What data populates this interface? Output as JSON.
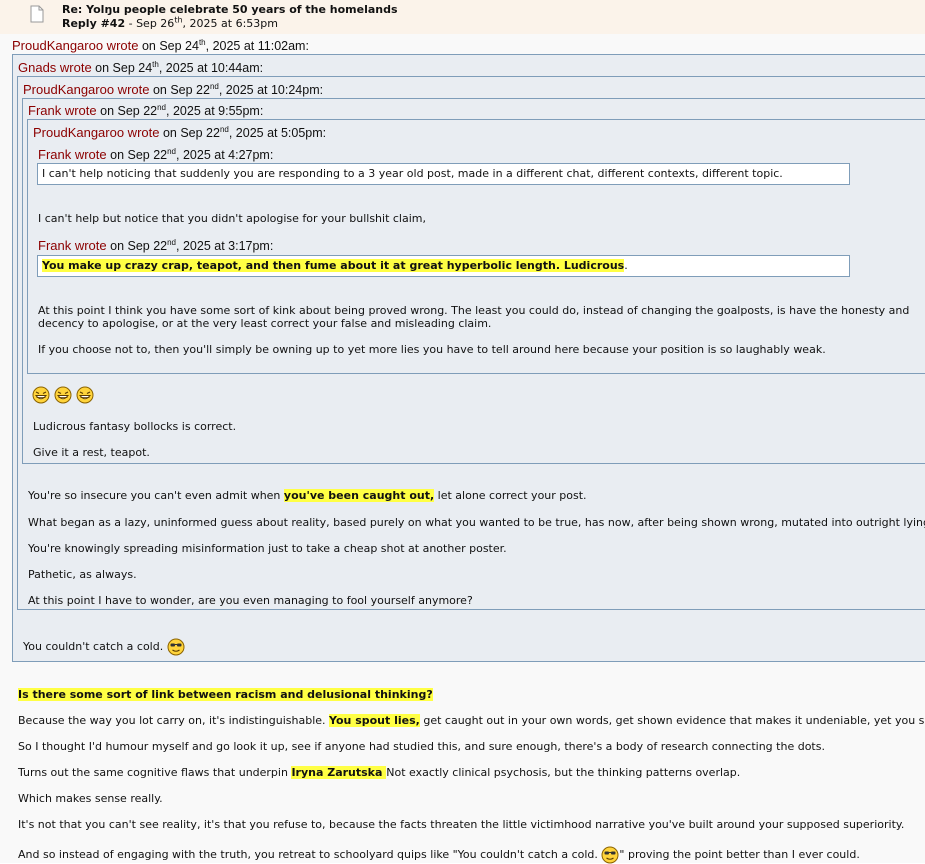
{
  "header": {
    "title": "Re: Yolŋu people celebrate 50 years of the homelands",
    "reply_label": "Reply #42",
    "date_pre": " - Sep 26",
    "date_sup": "th",
    "date_post": ", 2025 at 6:53pm"
  },
  "q0": {
    "author": "ProudKangaroo wrote",
    "pre": " on Sep 24",
    "sup": "th",
    "post": ", 2025 at 11:02am:"
  },
  "q1": {
    "author": "Gnads wrote",
    "pre": " on Sep 24",
    "sup": "th",
    "post": ", 2025 at 10:44am:"
  },
  "q2": {
    "author": "ProudKangaroo wrote",
    "pre": " on Sep 22",
    "sup": "nd",
    "post": ", 2025 at 10:24pm:"
  },
  "q3": {
    "author": "Frank wrote",
    "pre": " on Sep 22",
    "sup": "nd",
    "post": ", 2025 at 9:55pm:"
  },
  "q4": {
    "author": "ProudKangaroo wrote",
    "pre": " on Sep 22",
    "sup": "nd",
    "post": ", 2025 at 5:05pm:"
  },
  "q5": {
    "author": "Frank wrote",
    "pre": " on Sep 22",
    "sup": "nd",
    "post": ", 2025 at 4:27pm:",
    "quote_text": "I can't help noticing that suddenly you are responding to a 3 year old post, made in a different chat, different contexts, different topic."
  },
  "q4_body": {
    "notice": "I can't help but notice that you didn't apologise for your bullshit claim,"
  },
  "q6": {
    "author": "Frank wrote",
    "pre": " on Sep 22",
    "sup": "nd",
    "post": ", 2025 at 3:17pm:",
    "quote_text": "You make up crazy crap, teapot, and then fume about it at great hyperbolic length. Ludicrous",
    "quote_tail": "."
  },
  "q4_tail": {
    "p1a": "At this point I think you have some sort of kink about being proved wrong.  The least you could do, instead of changing the goalposts, is have the honesty and",
    "p1b": "decency to apologise, or at the very least correct your false and misleading claim.",
    "p2": "If you choose not to, then you'll simply be owning up to yet more lies you have to tell around here because your position is so laughably weak."
  },
  "q3_body": {
    "smileys": "laughing-icons",
    "p1": "Ludicrous fantasy bollocks is correct.",
    "p2": "Give it a rest, teapot."
  },
  "q2_body": {
    "p1_pre": "You're so insecure you can't even admit when ",
    "p1_hl": "you've been caught out,",
    "p1_post": " let alone correct your post.",
    "p2": "What began as a lazy, uninformed guess about reality, based purely on what you wanted to be true, has now, after being shown wrong, mutated into outright lying",
    "p3": "You're knowingly spreading misinformation just to take a cheap shot at another poster.",
    "p4": "Pathetic, as always.",
    "p5": "At this point I have to wonder, are you even managing to fool yourself anymore?"
  },
  "q1_body": {
    "p1": "You couldn't catch a cold. "
  },
  "post": {
    "heading": "Is there some sort of link between racism and delusional thinking?",
    "p1_pre": "Because the way you lot carry on, it's indistinguishable. ",
    "p1_hl": "You spout lies,",
    "p1_post": " get caught out in your own words, get shown evidence that makes it undeniable, yet you s",
    "p2": "So I thought I'd humour myself and go look it up, see if anyone had studied this, and sure enough, there's a body of research connecting the dots.",
    "p3_pre": "Turns out the same cognitive flaws that underpin ",
    "p3_hl": "Iryna Zarutska ",
    "p3_post": " Not exactly clinical psychosis, but the thinking patterns overlap.",
    "p4": "Which makes sense really.",
    "p5": "It's not that you can't see reality, it's that you refuse to, because the facts threaten the little victimhood narrative you've built around your supposed superiority.",
    "p6_pre": "And so instead of engaging with the truth, you retreat to schoolyard quips like \"You couldn't catch a cold. ",
    "p6_post": "\" proving the point better than I ever could."
  },
  "colors": {
    "author": "#8b0000",
    "quote_bg": "#e9edf2",
    "quote_border": "#7f9db9",
    "highlight": "#ffff44",
    "header_bg": "#fbf3ea"
  }
}
